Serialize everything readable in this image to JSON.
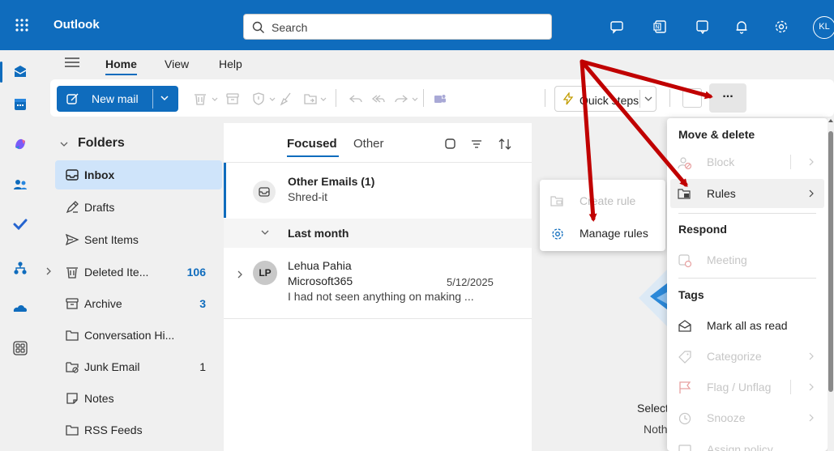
{
  "topbar": {
    "app_title": "Outlook",
    "search_placeholder": "Search",
    "avatar_initials": "KL"
  },
  "ribbon": {
    "tabs": [
      {
        "label": "Home",
        "selected": true
      },
      {
        "label": "View"
      },
      {
        "label": "Help"
      }
    ],
    "new_mail": "New mail",
    "quick_steps": "Quick steps",
    "more": "..."
  },
  "folders": {
    "header": "Folders",
    "items": [
      {
        "label": "Inbox",
        "count": "",
        "icon": "inbox-icon",
        "selected": true
      },
      {
        "label": "Drafts",
        "count": "",
        "icon": "drafts-icon"
      },
      {
        "label": "Sent Items",
        "count": "",
        "icon": "sent-icon"
      },
      {
        "label": "Deleted Ite...",
        "count": "106",
        "icon": "trash-icon"
      },
      {
        "label": "Archive",
        "count": "3",
        "icon": "archive-icon"
      },
      {
        "label": "Conversation Hi...",
        "count": "",
        "icon": "folder-icon"
      },
      {
        "label": "Junk Email",
        "count": "1",
        "icon": "junk-icon"
      },
      {
        "label": "Notes",
        "count": "",
        "icon": "notes-icon"
      },
      {
        "label": "RSS Feeds",
        "count": "",
        "icon": "folder-icon"
      }
    ]
  },
  "message_list": {
    "tab_focused": "Focused",
    "tab_other": "Other",
    "other_row": {
      "title": "Other Emails (1)",
      "subtitle": "Shred-it"
    },
    "section": "Last month",
    "messages": [
      {
        "initials": "LP",
        "sender": "Lehua Pahia",
        "subject": "Microsoft365",
        "date": "5/12/2025",
        "preview": "I had not seen anything on making ..."
      }
    ]
  },
  "reading_pane": {
    "select_text": "Select",
    "nothing_text": "Noth"
  },
  "rules_submenu": {
    "create_rule": "Create rule",
    "manage_rules": "Manage rules"
  },
  "more_menu": {
    "move_delete_header": "Move & delete",
    "block": "Block",
    "rules": "Rules",
    "respond_header": "Respond",
    "meeting": "Meeting",
    "tags_header": "Tags",
    "mark_all_read": "Mark all as read",
    "categorize": "Categorize",
    "flag_unflag": "Flag / Unflag",
    "snooze": "Snooze",
    "assign_policy": "Assign policy"
  },
  "colors": {
    "brand": "#0f6cbd",
    "arrow": "#c00000"
  }
}
